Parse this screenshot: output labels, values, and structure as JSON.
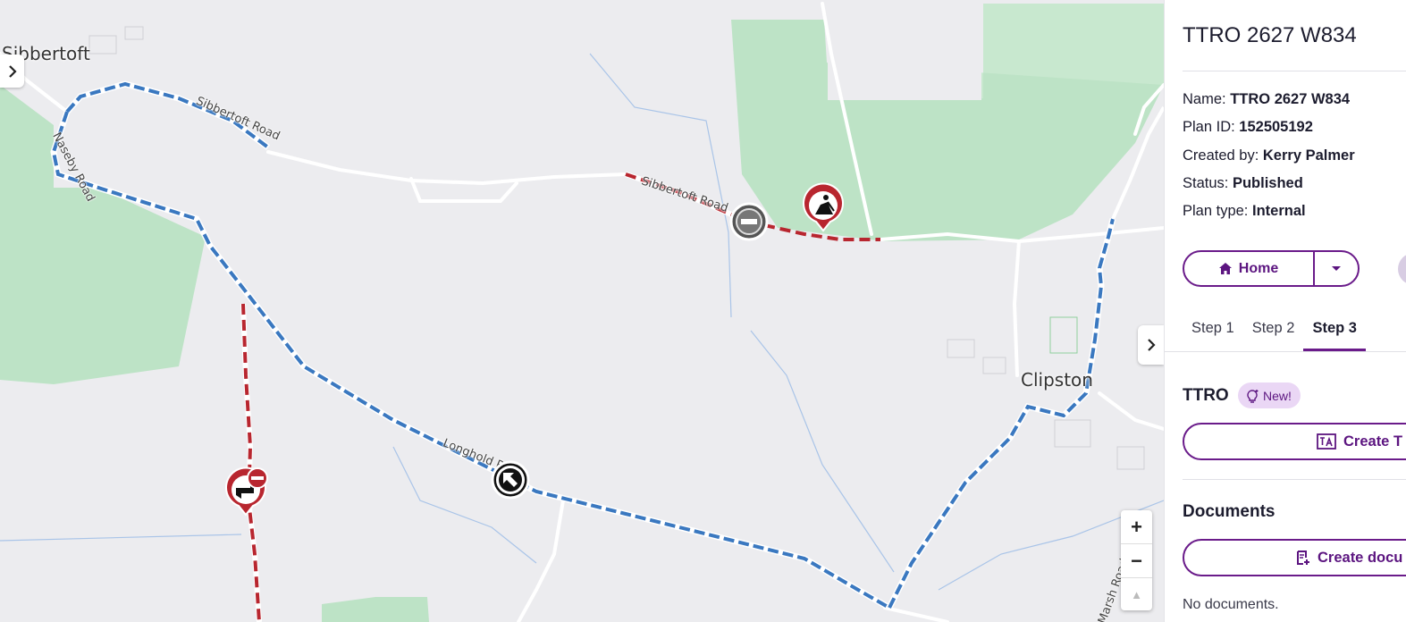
{
  "map": {
    "place_labels": [
      "Sibbertoft",
      "Clipston"
    ],
    "road_labels": [
      "Sibbertoft Road",
      "Sibbertoft Road",
      "Naseby Road",
      "Longhold Road",
      "Marsh Road"
    ],
    "zoom_in": "+",
    "zoom_out": "−",
    "reset_north": "▲",
    "colors": {
      "diversion": "#3a78c0",
      "closure": "#b8262f",
      "woodland": "#bde3c6",
      "background": "#ececef"
    },
    "markers": [
      "roadworks-icon",
      "no-entry-icon",
      "water-tap-icon",
      "direction-arrow-icon"
    ]
  },
  "panel": {
    "title": "TTRO 2627 W834",
    "details": [
      {
        "label": "Name:",
        "value": "TTRO 2627 W834"
      },
      {
        "label": "Plan ID:",
        "value": "152505192"
      },
      {
        "label": "Created by:",
        "value": "Kerry Palmer"
      },
      {
        "label": "Status:",
        "value": "Published"
      },
      {
        "label": "Plan type:",
        "value": "Internal"
      }
    ],
    "home_button": "Home",
    "tabs": [
      "Step 1",
      "Step 2",
      "Step 3"
    ],
    "active_tab": "Step 3",
    "ttro": {
      "heading": "TTRO",
      "badge": "New!",
      "create_button": "Create T"
    },
    "documents": {
      "heading": "Documents",
      "create_button": "Create docu",
      "empty_text": "No documents."
    },
    "accent_color": "#6a1b8a"
  }
}
